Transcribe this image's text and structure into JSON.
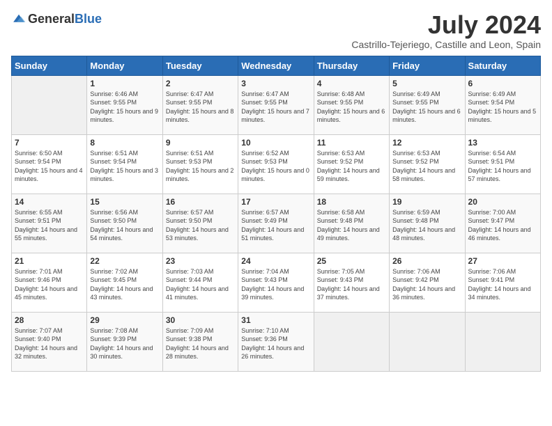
{
  "logo": {
    "text_general": "General",
    "text_blue": "Blue"
  },
  "title": "July 2024",
  "subtitle": "Castrillo-Tejeriego, Castille and Leon, Spain",
  "days_of_week": [
    "Sunday",
    "Monday",
    "Tuesday",
    "Wednesday",
    "Thursday",
    "Friday",
    "Saturday"
  ],
  "weeks": [
    [
      {
        "day": "",
        "sunrise": "",
        "sunset": "",
        "daylight": "",
        "empty": true
      },
      {
        "day": "1",
        "sunrise": "Sunrise: 6:46 AM",
        "sunset": "Sunset: 9:55 PM",
        "daylight": "Daylight: 15 hours and 9 minutes."
      },
      {
        "day": "2",
        "sunrise": "Sunrise: 6:47 AM",
        "sunset": "Sunset: 9:55 PM",
        "daylight": "Daylight: 15 hours and 8 minutes."
      },
      {
        "day": "3",
        "sunrise": "Sunrise: 6:47 AM",
        "sunset": "Sunset: 9:55 PM",
        "daylight": "Daylight: 15 hours and 7 minutes."
      },
      {
        "day": "4",
        "sunrise": "Sunrise: 6:48 AM",
        "sunset": "Sunset: 9:55 PM",
        "daylight": "Daylight: 15 hours and 6 minutes."
      },
      {
        "day": "5",
        "sunrise": "Sunrise: 6:49 AM",
        "sunset": "Sunset: 9:55 PM",
        "daylight": "Daylight: 15 hours and 6 minutes."
      },
      {
        "day": "6",
        "sunrise": "Sunrise: 6:49 AM",
        "sunset": "Sunset: 9:54 PM",
        "daylight": "Daylight: 15 hours and 5 minutes."
      }
    ],
    [
      {
        "day": "7",
        "sunrise": "Sunrise: 6:50 AM",
        "sunset": "Sunset: 9:54 PM",
        "daylight": "Daylight: 15 hours and 4 minutes."
      },
      {
        "day": "8",
        "sunrise": "Sunrise: 6:51 AM",
        "sunset": "Sunset: 9:54 PM",
        "daylight": "Daylight: 15 hours and 3 minutes."
      },
      {
        "day": "9",
        "sunrise": "Sunrise: 6:51 AM",
        "sunset": "Sunset: 9:53 PM",
        "daylight": "Daylight: 15 hours and 2 minutes."
      },
      {
        "day": "10",
        "sunrise": "Sunrise: 6:52 AM",
        "sunset": "Sunset: 9:53 PM",
        "daylight": "Daylight: 15 hours and 0 minutes."
      },
      {
        "day": "11",
        "sunrise": "Sunrise: 6:53 AM",
        "sunset": "Sunset: 9:52 PM",
        "daylight": "Daylight: 14 hours and 59 minutes."
      },
      {
        "day": "12",
        "sunrise": "Sunrise: 6:53 AM",
        "sunset": "Sunset: 9:52 PM",
        "daylight": "Daylight: 14 hours and 58 minutes."
      },
      {
        "day": "13",
        "sunrise": "Sunrise: 6:54 AM",
        "sunset": "Sunset: 9:51 PM",
        "daylight": "Daylight: 14 hours and 57 minutes."
      }
    ],
    [
      {
        "day": "14",
        "sunrise": "Sunrise: 6:55 AM",
        "sunset": "Sunset: 9:51 PM",
        "daylight": "Daylight: 14 hours and 55 minutes."
      },
      {
        "day": "15",
        "sunrise": "Sunrise: 6:56 AM",
        "sunset": "Sunset: 9:50 PM",
        "daylight": "Daylight: 14 hours and 54 minutes."
      },
      {
        "day": "16",
        "sunrise": "Sunrise: 6:57 AM",
        "sunset": "Sunset: 9:50 PM",
        "daylight": "Daylight: 14 hours and 53 minutes."
      },
      {
        "day": "17",
        "sunrise": "Sunrise: 6:57 AM",
        "sunset": "Sunset: 9:49 PM",
        "daylight": "Daylight: 14 hours and 51 minutes."
      },
      {
        "day": "18",
        "sunrise": "Sunrise: 6:58 AM",
        "sunset": "Sunset: 9:48 PM",
        "daylight": "Daylight: 14 hours and 49 minutes."
      },
      {
        "day": "19",
        "sunrise": "Sunrise: 6:59 AM",
        "sunset": "Sunset: 9:48 PM",
        "daylight": "Daylight: 14 hours and 48 minutes."
      },
      {
        "day": "20",
        "sunrise": "Sunrise: 7:00 AM",
        "sunset": "Sunset: 9:47 PM",
        "daylight": "Daylight: 14 hours and 46 minutes."
      }
    ],
    [
      {
        "day": "21",
        "sunrise": "Sunrise: 7:01 AM",
        "sunset": "Sunset: 9:46 PM",
        "daylight": "Daylight: 14 hours and 45 minutes."
      },
      {
        "day": "22",
        "sunrise": "Sunrise: 7:02 AM",
        "sunset": "Sunset: 9:45 PM",
        "daylight": "Daylight: 14 hours and 43 minutes."
      },
      {
        "day": "23",
        "sunrise": "Sunrise: 7:03 AM",
        "sunset": "Sunset: 9:44 PM",
        "daylight": "Daylight: 14 hours and 41 minutes."
      },
      {
        "day": "24",
        "sunrise": "Sunrise: 7:04 AM",
        "sunset": "Sunset: 9:43 PM",
        "daylight": "Daylight: 14 hours and 39 minutes."
      },
      {
        "day": "25",
        "sunrise": "Sunrise: 7:05 AM",
        "sunset": "Sunset: 9:43 PM",
        "daylight": "Daylight: 14 hours and 37 minutes."
      },
      {
        "day": "26",
        "sunrise": "Sunrise: 7:06 AM",
        "sunset": "Sunset: 9:42 PM",
        "daylight": "Daylight: 14 hours and 36 minutes."
      },
      {
        "day": "27",
        "sunrise": "Sunrise: 7:06 AM",
        "sunset": "Sunset: 9:41 PM",
        "daylight": "Daylight: 14 hours and 34 minutes."
      }
    ],
    [
      {
        "day": "28",
        "sunrise": "Sunrise: 7:07 AM",
        "sunset": "Sunset: 9:40 PM",
        "daylight": "Daylight: 14 hours and 32 minutes."
      },
      {
        "day": "29",
        "sunrise": "Sunrise: 7:08 AM",
        "sunset": "Sunset: 9:39 PM",
        "daylight": "Daylight: 14 hours and 30 minutes."
      },
      {
        "day": "30",
        "sunrise": "Sunrise: 7:09 AM",
        "sunset": "Sunset: 9:38 PM",
        "daylight": "Daylight: 14 hours and 28 minutes."
      },
      {
        "day": "31",
        "sunrise": "Sunrise: 7:10 AM",
        "sunset": "Sunset: 9:36 PM",
        "daylight": "Daylight: 14 hours and 26 minutes."
      },
      {
        "day": "",
        "sunrise": "",
        "sunset": "",
        "daylight": "",
        "empty": true
      },
      {
        "day": "",
        "sunrise": "",
        "sunset": "",
        "daylight": "",
        "empty": true
      },
      {
        "day": "",
        "sunrise": "",
        "sunset": "",
        "daylight": "",
        "empty": true
      }
    ]
  ]
}
